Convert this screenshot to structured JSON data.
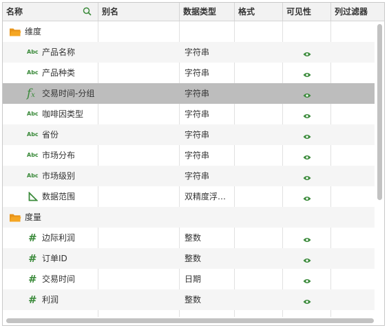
{
  "columns": {
    "name": "名称",
    "alias": "别名",
    "datatype": "数据类型",
    "format": "格式",
    "visibility": "可见性",
    "filter": "列过滤器"
  },
  "rows": [
    {
      "kind": "folder",
      "icon": "folder-icon",
      "name": "维度",
      "datatype": "",
      "visible": false
    },
    {
      "kind": "field",
      "icon": "abc-text-icon",
      "icon_text": "Abc",
      "name": "产品名称",
      "datatype": "字符串",
      "visible": true
    },
    {
      "kind": "field",
      "icon": "abc-text-icon",
      "icon_text": "Abc",
      "name": "产品种类",
      "datatype": "字符串",
      "visible": true
    },
    {
      "kind": "field",
      "icon": "fx-formula-icon",
      "icon_text": "fx",
      "name": "交易时间-分组",
      "datatype": "字符串",
      "visible": true,
      "selected": true
    },
    {
      "kind": "field",
      "icon": "abc-text-icon",
      "icon_text": "Abc",
      "name": "咖啡因类型",
      "datatype": "字符串",
      "visible": true
    },
    {
      "kind": "field",
      "icon": "abc-text-icon",
      "icon_text": "Abc",
      "name": "省份",
      "datatype": "字符串",
      "visible": true
    },
    {
      "kind": "field",
      "icon": "abc-text-icon",
      "icon_text": "Abc",
      "name": "市场分布",
      "datatype": "字符串",
      "visible": true
    },
    {
      "kind": "field",
      "icon": "abc-text-icon",
      "icon_text": "Abc",
      "name": "市场级别",
      "datatype": "字符串",
      "visible": true
    },
    {
      "kind": "field",
      "icon": "range-triangle-icon",
      "name": "数据范围",
      "datatype": "双精度浮…",
      "visible": true
    },
    {
      "kind": "folder",
      "icon": "folder-icon",
      "name": "度量",
      "datatype": "",
      "visible": false
    },
    {
      "kind": "field",
      "icon": "hash-number-icon",
      "icon_text": "#",
      "name": "边际利润",
      "datatype": "整数",
      "visible": true
    },
    {
      "kind": "field",
      "icon": "hash-number-icon",
      "icon_text": "#",
      "name": "订单ID",
      "datatype": "整数",
      "visible": true
    },
    {
      "kind": "field",
      "icon": "hash-number-icon",
      "icon_text": "#",
      "name": "交易时间",
      "datatype": "日期",
      "visible": true
    },
    {
      "kind": "field",
      "icon": "hash-number-icon",
      "icon_text": "#",
      "name": "利润",
      "datatype": "整数",
      "visible": true
    }
  ],
  "colors": {
    "accent_green": "#3a8a3a",
    "folder_orange": "#f5a623",
    "selected_row": "#bdbdbd",
    "alt_row": "#f5f5f5"
  }
}
